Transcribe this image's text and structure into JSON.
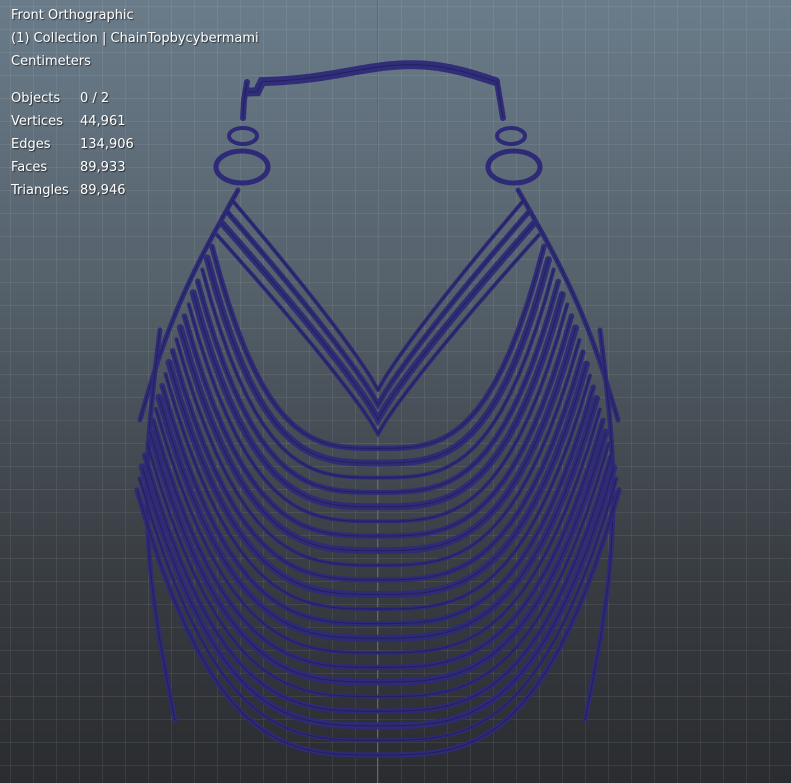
{
  "viewport": {
    "view_name": "Front Orthographic",
    "collection": "(1) Collection | ChainTopbycybermami",
    "units": "Centimeters"
  },
  "stats": [
    {
      "label": "Objects",
      "value": "0 / 2"
    },
    {
      "label": "Vertices",
      "value": "44,961"
    },
    {
      "label": "Edges",
      "value": "134,906"
    },
    {
      "label": "Faces",
      "value": "89,933"
    },
    {
      "label": "Triangles",
      "value": "89,946"
    }
  ],
  "colors": {
    "wireframe": "#2e2a78",
    "axis": "#3f6f9f"
  }
}
